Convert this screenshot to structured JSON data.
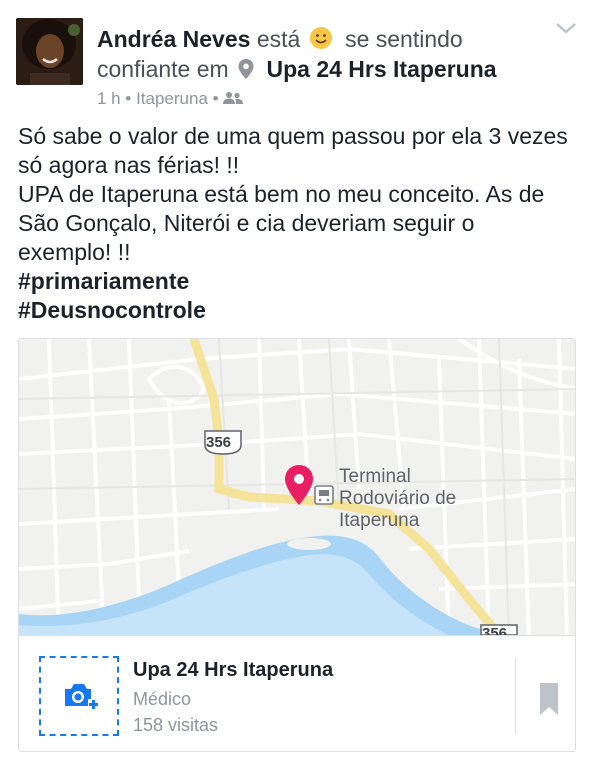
{
  "post": {
    "author": "Andréa Neves",
    "verb_before": "está",
    "feeling_after": "se sentindo",
    "feeling": "confiante",
    "location_prefix": "em",
    "place_name": "Upa 24 Hrs Itaperuna",
    "time": "1 h",
    "location": "Itaperuna",
    "audience_icon": "friends-icon",
    "lines": [
      "Só sabe o valor de uma quem passou por ela 3 vezes",
      "só agora nas férias! !!",
      "UPA de Itaperuna está bem no meu conceito. As de",
      "São Gonçalo, Niterói  e cia deveriam seguir o",
      "exemplo! !!"
    ],
    "hashtags": [
      "#primariamente",
      "#Deusnocontrole"
    ]
  },
  "map": {
    "road_shield_1": "356",
    "road_shield_2": "356",
    "poi_label": [
      "Terminal",
      "Rodoviário de",
      "Itaperuna"
    ],
    "colors": {
      "pin": "#e91e63",
      "river": "#a8d5f5",
      "road": "#f6e39a",
      "background": "#f1f1ef"
    }
  },
  "place_card": {
    "name": "Upa 24 Hrs Itaperuna",
    "category": "Médico",
    "visits": "158 visitas",
    "add_photo_icon": "camera-plus-icon",
    "save_icon": "bookmark-icon"
  },
  "colors": {
    "accent": "#1877f2",
    "text": "#1d2129",
    "secondary": "#90949c"
  }
}
